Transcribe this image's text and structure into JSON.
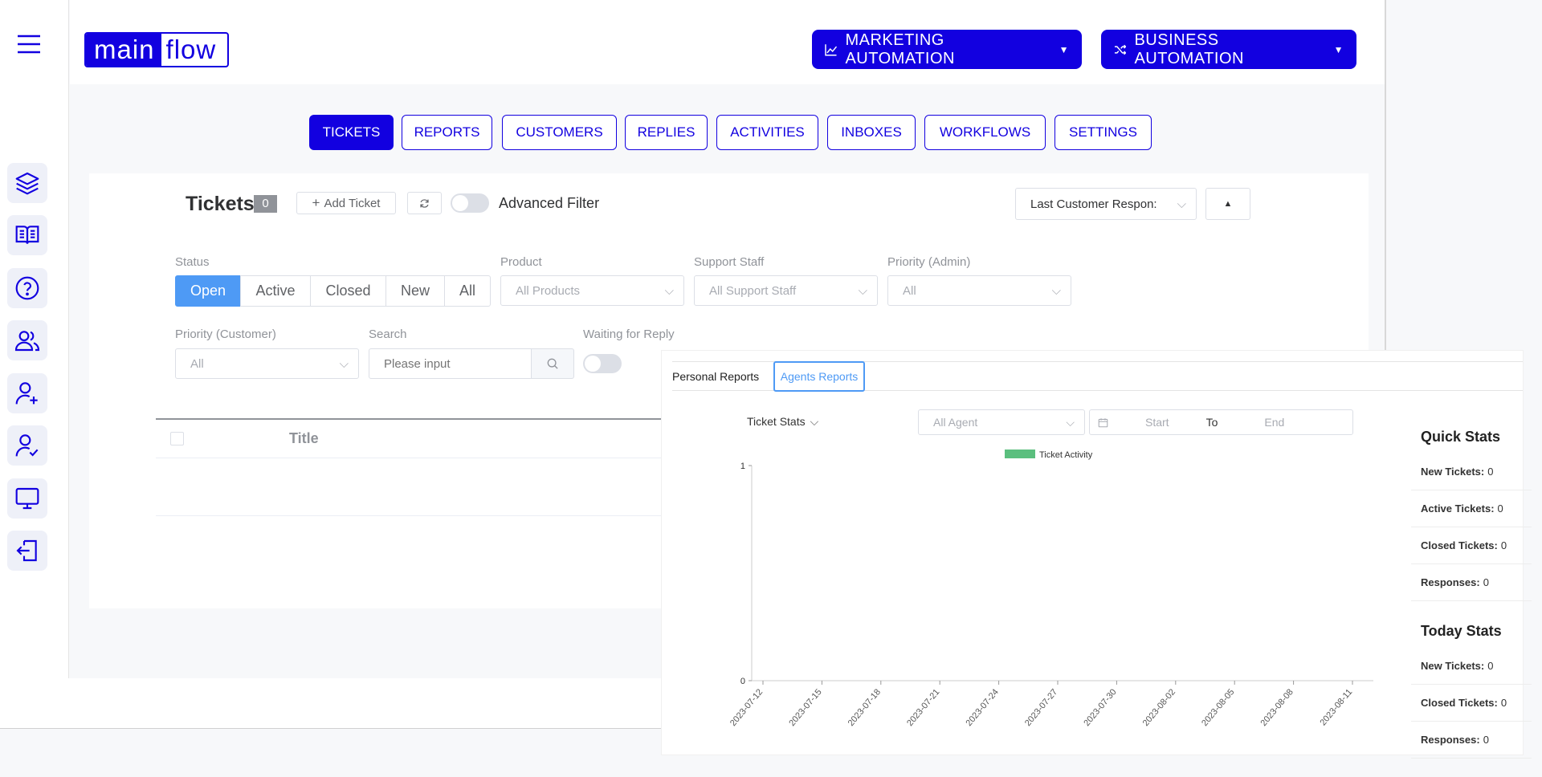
{
  "logo": {
    "part1": "main",
    "part2": "flow"
  },
  "header": {
    "marketing_label": "MARKETING AUTOMATION",
    "business_label": "BUSINESS AUTOMATION"
  },
  "nav": {
    "tabs": [
      {
        "label": "TICKETS",
        "active": true
      },
      {
        "label": "REPORTS"
      },
      {
        "label": "CUSTOMERS"
      },
      {
        "label": "REPLIES"
      },
      {
        "label": "ACTIVITIES"
      },
      {
        "label": "INBOXES"
      },
      {
        "label": "WORKFLOWS"
      },
      {
        "label": "SETTINGS"
      }
    ]
  },
  "sidebar": {
    "icons": [
      "layers-icon",
      "book-icon",
      "help-icon",
      "users-icon",
      "user-add-icon",
      "user-check-icon",
      "monitor-icon",
      "logout-icon"
    ]
  },
  "tickets": {
    "title": "Tickets",
    "count": "0",
    "add_label": "Add Ticket",
    "advanced_filter": "Advanced Filter",
    "sort_value": "Last Customer Respon:",
    "status_label": "Status",
    "status_options": [
      "Open",
      "Active",
      "Closed",
      "New",
      "All"
    ],
    "product_label": "Product",
    "product_value": "All Products",
    "staff_label": "Support Staff",
    "staff_value": "All Support Staff",
    "priority_admin_label": "Priority (Admin)",
    "priority_admin_value": "All",
    "priority_customer_label": "Priority (Customer)",
    "priority_customer_value": "All",
    "search_label": "Search",
    "search_placeholder": "Please input",
    "waiting_label": "Waiting for Reply",
    "table_title_header": "Title"
  },
  "reports": {
    "tabs": [
      "Personal Reports",
      "Agents Reports"
    ],
    "stats_selector": "Ticket Stats",
    "agent_value": "All Agent",
    "date_start": "Start",
    "date_to": "To",
    "date_end": "End",
    "quick_stats_title": "Quick Stats",
    "quick_stats": [
      {
        "label": "New Tickets:",
        "value": "0"
      },
      {
        "label": "Active Tickets:",
        "value": "0"
      },
      {
        "label": "Closed Tickets:",
        "value": "0"
      },
      {
        "label": "Responses:",
        "value": "0"
      }
    ],
    "today_stats_title": "Today Stats",
    "today_stats": [
      {
        "label": "New Tickets:",
        "value": "0"
      },
      {
        "label": "Closed Tickets:",
        "value": "0"
      },
      {
        "label": "Responses:",
        "value": "0"
      }
    ]
  },
  "colors": {
    "brand": "#1200e0",
    "active_blue": "#4e9af5",
    "series": "#5bbf7e"
  },
  "chart_data": {
    "type": "bar",
    "title": "",
    "legend": [
      "Ticket Activity"
    ],
    "categories": [
      "2023-07-12",
      "2023-07-15",
      "2023-07-18",
      "2023-07-21",
      "2023-07-24",
      "2023-07-27",
      "2023-07-30",
      "2023-08-02",
      "2023-08-05",
      "2023-08-08",
      "2023-08-11"
    ],
    "series": [
      {
        "name": "Ticket Activity",
        "values": [
          0,
          0,
          0,
          0,
          0,
          0,
          0,
          0,
          0,
          0,
          0
        ]
      }
    ],
    "ylim": [
      0,
      1
    ],
    "yticks": [
      "0",
      "1"
    ],
    "grid": false,
    "legend_position": "top"
  }
}
